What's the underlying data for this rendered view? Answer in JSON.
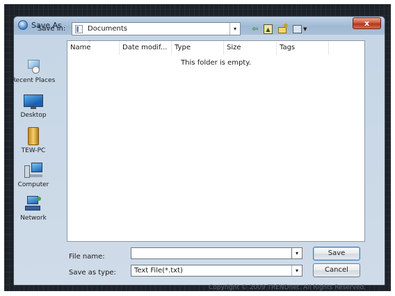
{
  "window": {
    "title": "Save As",
    "close_glyph": "x"
  },
  "toolbar": {
    "save_in_label": "Save in:",
    "save_in_value": "Documents",
    "dropdown_glyph": "▾",
    "back_icon": "back-arrow-icon",
    "up_icon": "up-one-level-icon",
    "new_folder_icon": "new-folder-icon",
    "views_icon": "views-menu-icon"
  },
  "places": [
    {
      "label": "Recent Places",
      "icon": "recent-places-icon"
    },
    {
      "label": "Desktop",
      "icon": "desktop-icon"
    },
    {
      "label": "TEW-PC",
      "icon": "user-folder-icon"
    },
    {
      "label": "Computer",
      "icon": "computer-icon"
    },
    {
      "label": "Network",
      "icon": "network-icon"
    }
  ],
  "filelist": {
    "columns": [
      "Name",
      "Date modif...",
      "Type",
      "Size",
      "Tags"
    ],
    "empty_message": "This folder is empty."
  },
  "form": {
    "file_name_label": "File name:",
    "file_name_value": "",
    "save_as_type_label": "Save as type:",
    "save_as_type_value": "Text File(*.txt)"
  },
  "buttons": {
    "save": "Save",
    "cancel": "Cancel"
  },
  "footer": {
    "copyright": "Copyright © 2009 TRENDnet. All Rights Reserved."
  },
  "colors": {
    "title_bar": "#a9c0d8",
    "close_button": "#c84a2e",
    "window_body": "#cfdbe8",
    "backdrop": "#1d2128"
  }
}
